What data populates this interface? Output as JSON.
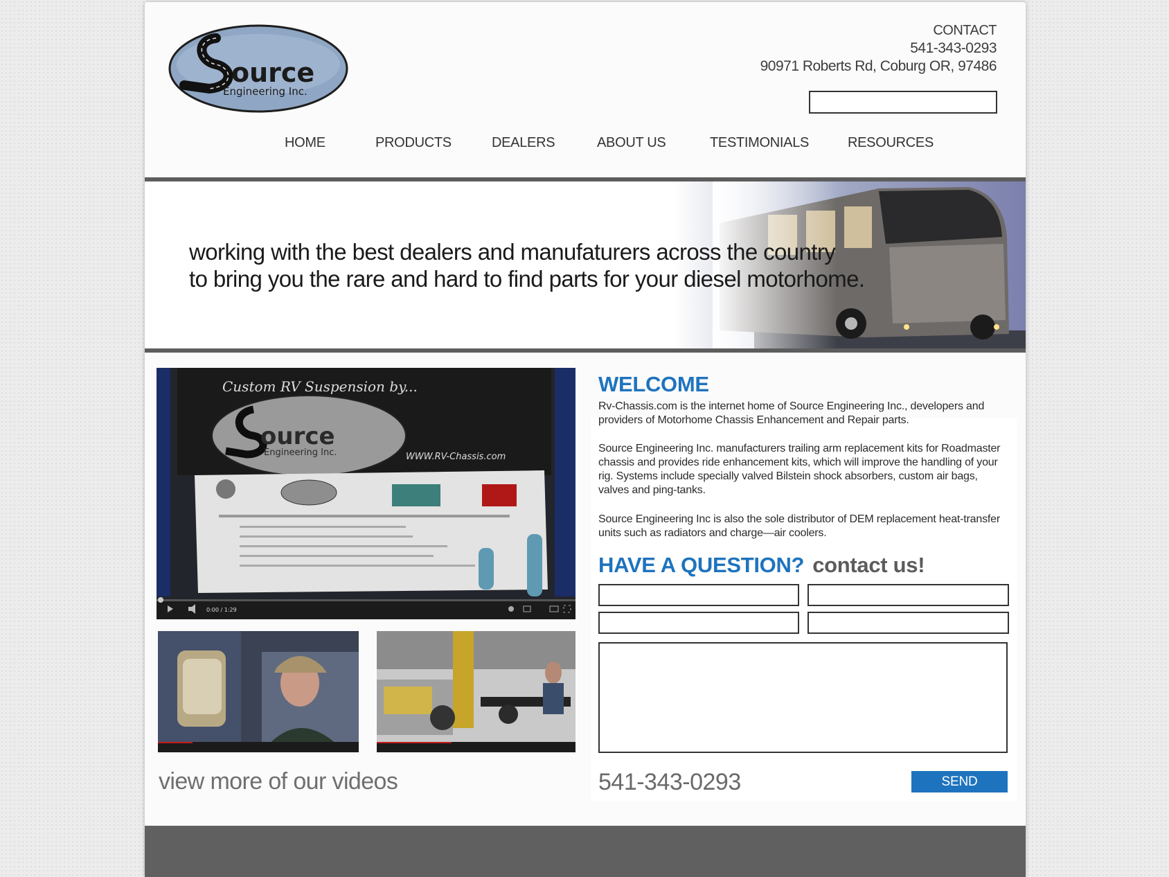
{
  "header": {
    "contact_title": "CONTACT",
    "phone": "541-343-0293",
    "address": "90971 Roberts Rd, Coburg OR, 97486",
    "search_value": "",
    "logo": {
      "main": "ource",
      "sub": "Engineering Inc."
    }
  },
  "nav": {
    "items": [
      "HOME",
      "PRODUCTS",
      "DEALERS",
      "ABOUT US",
      "TESTIMONIALS",
      "RESOURCES"
    ]
  },
  "banner": {
    "line1": "working with the best dealers and manufaturers across the country",
    "line2": "to bring you the rare and hard to find parts for your diesel motorhome."
  },
  "videos": {
    "main_player": {
      "banner_title": "Custom RV Suspension by...",
      "banner_url": "WWW.RV-Chassis.com",
      "time": "0:00 / 1:29"
    },
    "view_more": "view more of our videos"
  },
  "welcome": {
    "heading": "WELCOME",
    "p1": "Rv-Chassis.com is the internet home of Source Engineering Inc., developers and providers of Motorhome Chassis Enhancement and Repair parts.",
    "p2": "Source Engineering Inc. manufacturers trailing arm replacement kits for Roadmaster chassis and provides ride enhancement kits, which will improve the handling of your rig. Systems include specially valved Bilstein shock absorbers, custom air bags, valves and ping-tanks.",
    "p3": "Source Engineering Inc is also the sole distributor of DEM replacement heat-transfer units such as radiators and charge—air coolers."
  },
  "contact_form": {
    "heading_bold": "HAVE A QUESTION?",
    "heading_light": "contact us!",
    "phone": "541-343-0293",
    "send_label": "SEND"
  },
  "colors": {
    "accent": "#1e73be",
    "footer": "#606060",
    "text_dark": "#333333"
  }
}
